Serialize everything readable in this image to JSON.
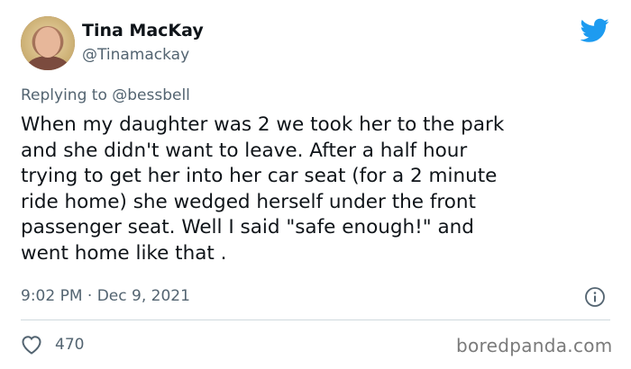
{
  "author": {
    "display_name": "Tina MacKay",
    "handle": "@Tinamackay"
  },
  "reply": {
    "prefix": "Replying to ",
    "mention": "@bessbell"
  },
  "tweet": {
    "text": "When my daughter was 2 we took her to the park\nand she didn't want to leave. After a half hour\ntrying to get her into her car seat (for a 2 minute\nride home) she wedged herself under the front\npassenger seat. Well I said \"safe enough!\" and\nwent home like that .",
    "timestamp": "9:02 PM · Dec 9, 2021"
  },
  "engagement": {
    "likes": "470"
  },
  "watermark": "boredpanda.com",
  "icons": {
    "brand": "twitter-bird-icon",
    "info": "info-icon",
    "like": "heart-icon"
  },
  "colors": {
    "twitter_blue": "#1d9bf0",
    "secondary_text": "#536471",
    "divider": "#cfd9de"
  }
}
